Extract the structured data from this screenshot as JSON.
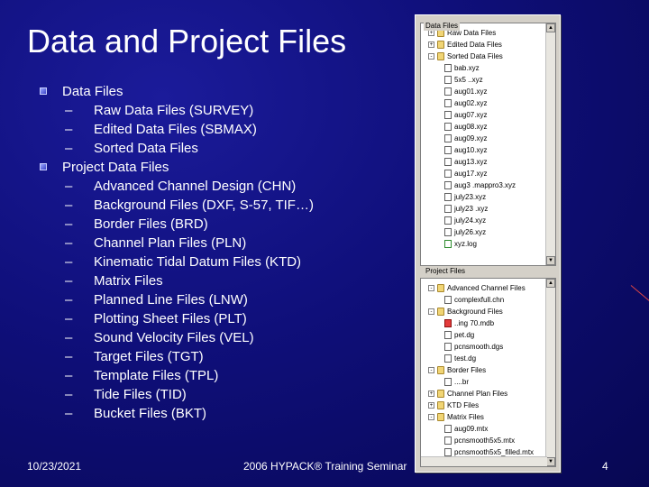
{
  "slide": {
    "title": "Data and Project Files",
    "bullets": [
      {
        "label": "Data Files",
        "children": [
          "Raw Data Files (SURVEY)",
          "Edited Data Files (SBMAX)",
          "Sorted Data Files"
        ]
      },
      {
        "label": "Project Data Files",
        "children": [
          "Advanced Channel Design (CHN)",
          "Background Files (DXF, S-57, TIF…)",
          "Border Files (BRD)",
          "Channel Plan Files (PLN)",
          "Kinematic Tidal Datum Files (KTD)",
          "Matrix Files",
          "Planned Line Files (LNW)",
          "Plotting Sheet Files (PLT)",
          "Sound Velocity Files (VEL)",
          "Target Files (TGT)",
          "Template Files (TPL)",
          "Tide Files (TID)",
          "Bucket Files (BKT)"
        ]
      }
    ],
    "dash": "–",
    "footer": {
      "date": "10/23/2021",
      "seminar": "2006 HYPACK® Training Seminar",
      "page": "4"
    }
  },
  "explorer": {
    "data_files_title": "Data Files",
    "project_files_title": "Project Files",
    "data_tree": [
      {
        "label": "Raw Data Files",
        "type": "folder",
        "depth": 0,
        "toggle": "+"
      },
      {
        "label": "Edited Data Files",
        "type": "folder",
        "depth": 0,
        "toggle": "+"
      },
      {
        "label": "Sorted Data Files",
        "type": "folder",
        "depth": 0,
        "toggle": "-"
      },
      {
        "label": "bab.xyz",
        "type": "file",
        "depth": 1
      },
      {
        "label": "5x5 ..xyz",
        "type": "file",
        "depth": 1
      },
      {
        "label": "aug01.xyz",
        "type": "file",
        "depth": 1
      },
      {
        "label": "aug02.xyz",
        "type": "file",
        "depth": 1
      },
      {
        "label": "aug07.xyz",
        "type": "file",
        "depth": 1
      },
      {
        "label": "aug08.xyz",
        "type": "file",
        "depth": 1
      },
      {
        "label": "aug09.xyz",
        "type": "file",
        "depth": 1
      },
      {
        "label": "aug10.xyz",
        "type": "file",
        "depth": 1
      },
      {
        "label": "aug13.xyz",
        "type": "file",
        "depth": 1
      },
      {
        "label": "aug17.xyz",
        "type": "file",
        "depth": 1
      },
      {
        "label": "aug3 .mappro3.xyz",
        "type": "file",
        "depth": 1
      },
      {
        "label": "july23.xyz",
        "type": "file",
        "depth": 1
      },
      {
        "label": "july23 .xyz",
        "type": "file",
        "depth": 1
      },
      {
        "label": "july24.xyz",
        "type": "file",
        "depth": 1
      },
      {
        "label": "july26.xyz",
        "type": "file",
        "depth": 1
      },
      {
        "label": "xyz.log",
        "type": "file-green",
        "depth": 1
      }
    ],
    "project_tree": [
      {
        "label": "Advanced Channel Files",
        "type": "folder",
        "depth": 0,
        "toggle": "-"
      },
      {
        "label": "complexfull.chn",
        "type": "file",
        "depth": 1
      },
      {
        "label": "Background Files",
        "type": "folder",
        "depth": 0,
        "toggle": "-"
      },
      {
        "label": "..ing 70.mdb",
        "type": "file-red",
        "depth": 1
      },
      {
        "label": "pet.dg",
        "type": "file",
        "depth": 1
      },
      {
        "label": "pcnsmooth.dgs",
        "type": "file",
        "depth": 1
      },
      {
        "label": "test.dg",
        "type": "file",
        "depth": 1
      },
      {
        "label": "Border Files",
        "type": "folder",
        "depth": 0,
        "toggle": "-"
      },
      {
        "label": "....br",
        "type": "file",
        "depth": 1
      },
      {
        "label": "Channel Plan Files",
        "type": "folder",
        "depth": 0,
        "toggle": "+"
      },
      {
        "label": "KTD Files",
        "type": "folder",
        "depth": 0,
        "toggle": "+"
      },
      {
        "label": "Matrix Files",
        "type": "folder",
        "depth": 0,
        "toggle": "-"
      },
      {
        "label": "aug09.mtx",
        "type": "file",
        "depth": 1
      },
      {
        "label": "pcnsmooth5x5.mtx",
        "type": "file",
        "depth": 1
      },
      {
        "label": "pcnsmooth5x5_filled.mtx",
        "type": "file",
        "depth": 1
      }
    ],
    "colors": {
      "background": "#0f0f7a",
      "panel": "#d4d0c8",
      "folder": "#f1d575"
    }
  }
}
